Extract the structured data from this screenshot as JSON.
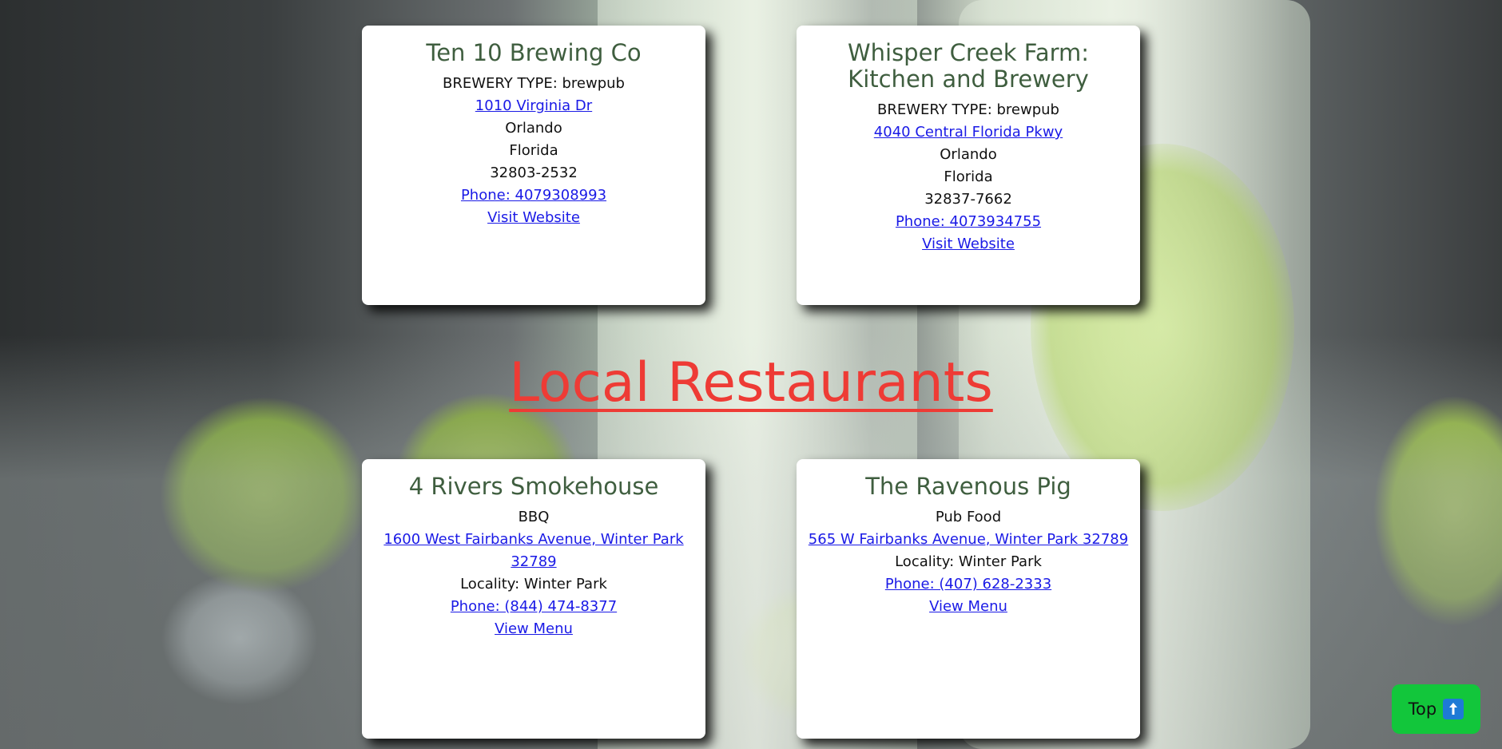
{
  "breweries": [
    {
      "name": "Ten 10 Brewing Co",
      "type_line": "BREWERY TYPE: brewpub",
      "street": "1010 Virginia Dr",
      "city": "Orlando",
      "state": "Florida",
      "postal": "32803-2532",
      "phone": "Phone: 4079308993",
      "website": "Visit Website"
    },
    {
      "name": "Whisper Creek Farm: Kitchen and Brewery",
      "type_line": "BREWERY TYPE: brewpub",
      "street": "4040 Central Florida Pkwy",
      "city": "Orlando",
      "state": "Florida",
      "postal": "32837-7662",
      "phone": "Phone: 4073934755",
      "website": "Visit Website"
    }
  ],
  "restaurants_heading": "Local Restaurants",
  "restaurants": [
    {
      "name": "4 Rivers Smokehouse",
      "cuisine": "BBQ",
      "address": "1600 West Fairbanks Avenue, Winter Park 32789",
      "locality": "Locality: Winter Park",
      "phone": "Phone: (844) 474-8377",
      "menu": "View Menu"
    },
    {
      "name": "The Ravenous Pig",
      "cuisine": "Pub Food",
      "address": "565 W Fairbanks Avenue, Winter Park 32789",
      "locality": "Locality: Winter Park",
      "phone": "Phone: (407) 628-2333",
      "menu": "View Menu"
    }
  ],
  "top_button": {
    "label": "Top",
    "icon": "up-arrow-icon",
    "color": "#12c63b"
  },
  "colors": {
    "heading": "#ee3b35",
    "card_title": "#3f5e3f",
    "link": "#1a1ae6"
  }
}
